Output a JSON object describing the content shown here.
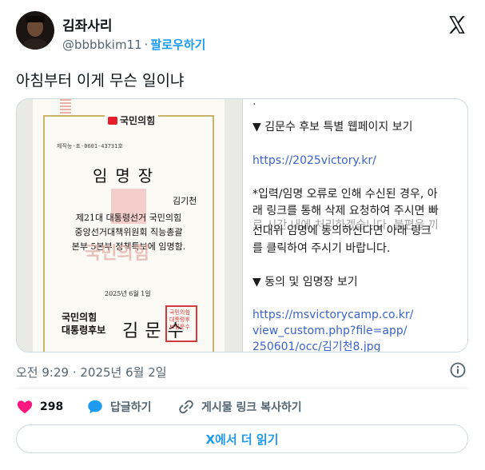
{
  "author": {
    "name": "김좌사리",
    "handle": "@bbbbkim11",
    "separator": "·",
    "follow_label": "팔로우하기"
  },
  "tweet": {
    "text": "아침부터 이게 무슨 일이냐"
  },
  "media": {
    "document": {
      "party_logo": "국민의힘",
      "serial": "제직능-조-0601-43731호",
      "title": "임명장",
      "person": "김기천",
      "body_lines": [
        "제21대 대통령선거 국민의힘",
        "중앙선거대책위원회 직능총괄",
        "본부 5본부 정책특보에 임명함."
      ],
      "watermark": "국민의힘",
      "date": "2025년 6월 1일",
      "signer_org_lines": [
        "국민의힘",
        "대통령후보"
      ],
      "signer_name": "김문수",
      "seal_text": "국민의힘대통령후보김문수"
    },
    "message": {
      "top_partial": ".",
      "heading1": "▼ 김문수 후보 특별 웹페이지 보기",
      "link1": "https://2025victory.kr/",
      "notice_line1": "*입력/임명 오류로 인해 수신된 경우, 아",
      "notice_line2": "래 링크를 통해 삭제 요청하여 주시면 빠",
      "notice_overlap": "르 시간 내에 처리하겠습니다. 불편을 끼",
      "notice_line3": "선대위 임명에 동의하신다면 아래 링크",
      "notice_line4": "를 클릭하여 주시기 바랍니다.",
      "heading2": "▼ 동의 및 임명장 보기",
      "link2_line1": "https://msvictorycamp.co.kr/",
      "link2_line2": "view_custom.php?file=app/",
      "link2_line3": "250601/occ/김기천8.jpg"
    }
  },
  "meta": {
    "timestamp": "오전 9:29 · 2025년 6월 2일"
  },
  "actions": {
    "likes_count": "298",
    "reply_label": "답글하기",
    "copy_link_label": "게시물 링크 복사하기"
  },
  "read_more_label": "X에서 더 읽기",
  "icons": {
    "like": "heart-icon",
    "reply": "speech-bubble-icon",
    "copy": "link-icon",
    "info": "info-icon",
    "logo": "x-logo-icon"
  },
  "colors": {
    "accent": "#1d9bf0",
    "like": "#f91880",
    "text": "#0f1419",
    "muted": "#536471",
    "party_red": "#e61e2b"
  }
}
